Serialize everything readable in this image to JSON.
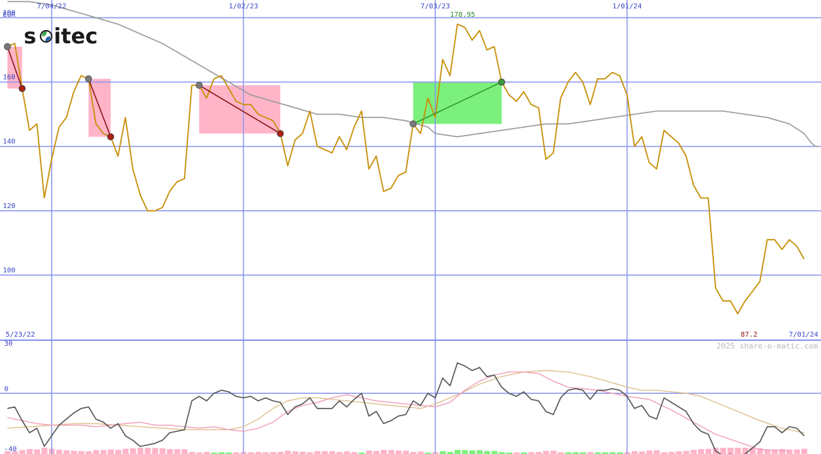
{
  "logo": {
    "text": "soitec"
  },
  "currency": "EUR",
  "watermark": "2025 share-o-matic.com",
  "colors": {
    "price": "#c8900a",
    "ma": "#9a9a9a",
    "grid": "#8a95f0",
    "axis_text": "#3a46c8",
    "gain": "#7cf07c",
    "loss": "#ffb4c8",
    "gain_line": "#2a9a2a",
    "loss_line": "#8a1010",
    "osc_fast": "#555555",
    "osc_mid": "#f0a0b8",
    "osc_slow": "#e0c090"
  },
  "chart_data": [
    {
      "type": "line",
      "title": "",
      "ylabel": "EUR",
      "ylim": [
        79.8,
        185.5
      ],
      "y_ticks": [
        "180",
        "160",
        "140",
        "120",
        "100"
      ],
      "x_date_labels": [
        "7/04/22",
        "1/02/23",
        "7/03/23",
        "1/01/24"
      ],
      "x_range_labels": [
        "5/23/22",
        "7/01/24"
      ],
      "grid": true,
      "annotations": {
        "high": "178.95",
        "low": "87.2"
      },
      "series": [
        {
          "role": "price",
          "values": [
            171,
            172,
            158,
            145,
            147,
            124,
            136,
            146,
            149,
            157,
            162,
            161,
            147,
            144,
            143,
            137,
            149,
            133,
            125,
            120,
            120,
            121,
            126,
            129,
            130,
            159,
            159,
            155,
            161,
            162,
            158,
            154,
            153,
            153,
            150,
            149,
            148,
            144,
            134,
            142,
            144,
            151,
            140,
            139,
            138,
            143,
            139,
            146,
            151,
            133,
            137,
            126,
            127,
            131,
            132,
            147,
            144,
            155,
            149,
            167,
            162,
            178,
            177,
            173,
            176,
            170,
            171,
            160,
            156,
            154,
            157,
            153,
            152,
            136,
            138,
            155,
            160,
            163,
            160,
            153,
            161,
            161,
            163,
            162,
            156,
            140,
            143,
            135,
            133,
            145,
            143,
            141,
            137,
            128,
            124,
            124,
            96,
            92,
            92,
            88,
            92,
            95,
            98,
            111,
            111,
            108,
            111,
            109,
            105
          ],
          "x": [
            "2022-05-23",
            "2022-05-30",
            "2022-06-06",
            "2022-06-13",
            "2022-06-20",
            "2022-06-27",
            "2022-07-04",
            "2022-07-11",
            "2022-07-18",
            "2022-07-25",
            "2022-08-01",
            "2022-08-08",
            "2022-08-15",
            "2022-08-22",
            "2022-08-29",
            "2022-09-05",
            "2022-09-12",
            "2022-09-19",
            "2022-09-26",
            "2022-10-03",
            "2022-10-10",
            "2022-10-17",
            "2022-10-24",
            "2022-10-31",
            "2022-11-07",
            "2022-11-14",
            "2022-11-21",
            "2022-11-28",
            "2022-12-05",
            "2022-12-12",
            "2022-12-19",
            "2022-12-26",
            "2023-01-02",
            "2023-01-09",
            "2023-01-16",
            "2023-01-23",
            "2023-01-30",
            "2023-02-06",
            "2023-02-13",
            "2023-02-20",
            "2023-02-27",
            "2023-03-06",
            "2023-03-13",
            "2023-03-20",
            "2023-03-27",
            "2023-04-03",
            "2023-04-10",
            "2023-04-17",
            "2023-04-24",
            "2023-05-01",
            "2023-05-08",
            "2023-05-15",
            "2023-05-22",
            "2023-05-29",
            "2023-06-05",
            "2023-06-12",
            "2023-06-19",
            "2023-06-26",
            "2023-07-03",
            "2023-07-10",
            "2023-07-17",
            "2023-07-24",
            "2023-07-31",
            "2023-08-07",
            "2023-08-14",
            "2023-08-21",
            "2023-08-28",
            "2023-09-04",
            "2023-09-11",
            "2023-09-18",
            "2023-09-25",
            "2023-10-02",
            "2023-10-09",
            "2023-10-16",
            "2023-10-23",
            "2023-10-30",
            "2023-11-06",
            "2023-11-13",
            "2023-11-20",
            "2023-11-27",
            "2023-12-04",
            "2023-12-11",
            "2023-12-18",
            "2023-12-25",
            "2024-01-01",
            "2024-01-08",
            "2024-01-15",
            "2024-01-22",
            "2024-01-29",
            "2024-02-05",
            "2024-02-12",
            "2024-02-19",
            "2024-02-26",
            "2024-03-04",
            "2024-03-11",
            "2024-03-18",
            "2024-03-25",
            "2024-04-01",
            "2024-04-08",
            "2024-04-15",
            "2024-04-22",
            "2024-04-29",
            "2024-05-06",
            "2024-05-13",
            "2024-05-20",
            "2024-05-27",
            "2024-06-03",
            "2024-06-10",
            "2024-06-17"
          ]
        },
        {
          "role": "moving-average",
          "values": [
            185,
            185,
            184,
            182,
            180,
            178,
            175,
            172,
            168,
            164,
            160,
            156,
            154,
            152,
            150,
            150,
            149,
            149,
            148,
            146,
            144,
            143,
            144,
            145,
            146,
            147,
            147,
            148,
            149,
            150,
            151,
            151,
            151,
            151,
            150,
            149,
            147,
            144,
            141,
            140,
            140
          ],
          "x": [
            "2022-05-23",
            "2022-06-13",
            "2022-07-04",
            "2022-07-25",
            "2022-08-15",
            "2022-09-05",
            "2022-09-26",
            "2022-10-17",
            "2022-11-07",
            "2022-11-28",
            "2022-12-19",
            "2023-01-09",
            "2023-01-30",
            "2023-02-20",
            "2023-03-13",
            "2023-04-03",
            "2023-04-24",
            "2023-05-15",
            "2023-06-05",
            "2023-06-26",
            "2023-07-03",
            "2023-07-24",
            "2023-08-14",
            "2023-09-04",
            "2023-09-25",
            "2023-10-16",
            "2023-11-06",
            "2023-11-27",
            "2023-12-18",
            "2024-01-08",
            "2024-01-29",
            "2024-02-19",
            "2024-03-11",
            "2024-04-01",
            "2024-04-22",
            "2024-05-13",
            "2024-06-03",
            "2024-06-17",
            "2024-06-24",
            "2024-06-28",
            "2024-07-01"
          ]
        }
      ],
      "trades": [
        {
          "entry_date": "2022-05-23",
          "entry": 171,
          "exit_date": "2022-06-06",
          "exit": 158,
          "result": "loss"
        },
        {
          "entry_date": "2022-08-08",
          "entry": 161,
          "exit_date": "2022-08-29",
          "exit": 143,
          "result": "loss"
        },
        {
          "entry_date": "2022-11-21",
          "entry": 159,
          "exit_date": "2023-02-06",
          "exit": 144,
          "result": "loss"
        },
        {
          "entry_date": "2023-06-12",
          "entry": 147,
          "exit_date": "2023-09-04",
          "exit": 160,
          "result": "gain"
        }
      ]
    },
    {
      "type": "line",
      "title": "",
      "ylim": [
        -40,
        35
      ],
      "y_ticks": [
        "30",
        "0",
        "-40"
      ],
      "grid": true,
      "series": [
        {
          "role": "oscillator-fast",
          "values": [
            -10,
            -9,
            -18,
            -26,
            -23,
            -35,
            -28,
            -21,
            -17,
            -13,
            -10,
            -9,
            -17,
            -19,
            -23,
            -20,
            -28,
            -31,
            -35,
            -34,
            -33,
            -31,
            -26,
            -25,
            -24,
            -5,
            -2,
            -5,
            0,
            2,
            1,
            -2,
            -3,
            -2,
            -5,
            -3,
            -5,
            -6,
            -14,
            -9,
            -7,
            -3,
            -10,
            -10,
            -10,
            -5,
            -9,
            -4,
            0,
            -15,
            -12,
            -20,
            -18,
            -15,
            -14,
            -5,
            -8,
            0,
            -3,
            10,
            5,
            20,
            18,
            15,
            17,
            11,
            12,
            4,
            0,
            -2,
            1,
            -4,
            -5,
            -12,
            -14,
            -3,
            2,
            3,
            2,
            -4,
            2,
            2,
            3,
            2,
            -2,
            -10,
            -8,
            -15,
            -17,
            -3,
            -6,
            -9,
            -12,
            -20,
            -25,
            -27,
            -38,
            -41,
            -40,
            -43,
            -40,
            -36,
            -32,
            -22,
            -22,
            -26,
            -22,
            -23,
            -28
          ],
          "x_ref": "price"
        },
        {
          "role": "oscillator-mid",
          "values": [
            -16,
            -18,
            -20,
            -21,
            -21,
            -21,
            -22,
            -21,
            -20,
            -19,
            -21,
            -21,
            -22,
            -23,
            -22,
            -24,
            -25,
            -23,
            -19,
            -12,
            -8,
            -6,
            -3,
            -1,
            -3,
            -5,
            -6,
            -7,
            -8,
            -9,
            -6,
            2,
            8,
            12,
            14,
            14,
            13,
            8,
            4,
            3,
            2,
            0,
            -2,
            -4,
            -11,
            -19,
            -27,
            -32,
            -37,
            -38
          ],
          "x": [
            "2022-05-23",
            "2022-06-06",
            "2022-06-20",
            "2022-07-04",
            "2022-07-18",
            "2022-08-01",
            "2022-08-15",
            "2022-08-29",
            "2022-09-12",
            "2022-09-26",
            "2022-10-10",
            "2022-10-24",
            "2022-11-07",
            "2022-11-21",
            "2022-12-05",
            "2022-12-19",
            "2023-01-02",
            "2023-01-16",
            "2023-01-30",
            "2023-02-13",
            "2023-02-27",
            "2023-03-13",
            "2023-03-27",
            "2023-04-10",
            "2023-04-24",
            "2023-05-08",
            "2023-05-22",
            "2023-06-05",
            "2023-06-19",
            "2023-07-03",
            "2023-07-17",
            "2023-07-31",
            "2023-08-14",
            "2023-08-28",
            "2023-09-11",
            "2023-09-25",
            "2023-10-09",
            "2023-10-23",
            "2023-11-06",
            "2023-11-20",
            "2023-12-04",
            "2023-12-18",
            "2024-01-01",
            "2024-01-22",
            "2024-02-12",
            "2024-03-04",
            "2024-03-25",
            "2024-04-15",
            "2024-05-06",
            "2024-06-03"
          ]
        },
        {
          "role": "oscillator-slow",
          "values": [
            -23,
            -22,
            -21,
            -20,
            -20,
            -21,
            -22,
            -23,
            -24,
            -24,
            -24,
            -24,
            -22,
            -17,
            -10,
            -5,
            -3,
            -3,
            -4,
            -5,
            -6,
            -7,
            -8,
            -9,
            -10,
            -7,
            -1,
            6,
            11,
            14,
            15,
            14,
            11,
            7,
            4,
            2,
            2,
            1,
            0,
            -2,
            -6,
            -12,
            -18,
            -23,
            -26
          ],
          "x": [
            "2022-05-23",
            "2022-06-13",
            "2022-07-04",
            "2022-07-25",
            "2022-08-15",
            "2022-09-05",
            "2022-09-26",
            "2022-10-17",
            "2022-11-07",
            "2022-11-21",
            "2022-12-05",
            "2022-12-19",
            "2023-01-02",
            "2023-01-16",
            "2023-01-30",
            "2023-02-13",
            "2023-02-27",
            "2023-03-13",
            "2023-03-27",
            "2023-04-10",
            "2023-04-24",
            "2023-05-08",
            "2023-05-22",
            "2023-06-05",
            "2023-06-19",
            "2023-07-03",
            "2023-07-24",
            "2023-08-14",
            "2023-09-04",
            "2023-09-25",
            "2023-10-16",
            "2023-11-06",
            "2023-11-27",
            "2023-12-18",
            "2024-01-01",
            "2024-01-15",
            "2024-01-29",
            "2024-02-12",
            "2024-02-26",
            "2024-03-11",
            "2024-03-25",
            "2024-04-15",
            "2024-05-06",
            "2024-05-27",
            "2024-06-17"
          ]
        }
      ]
    }
  ]
}
